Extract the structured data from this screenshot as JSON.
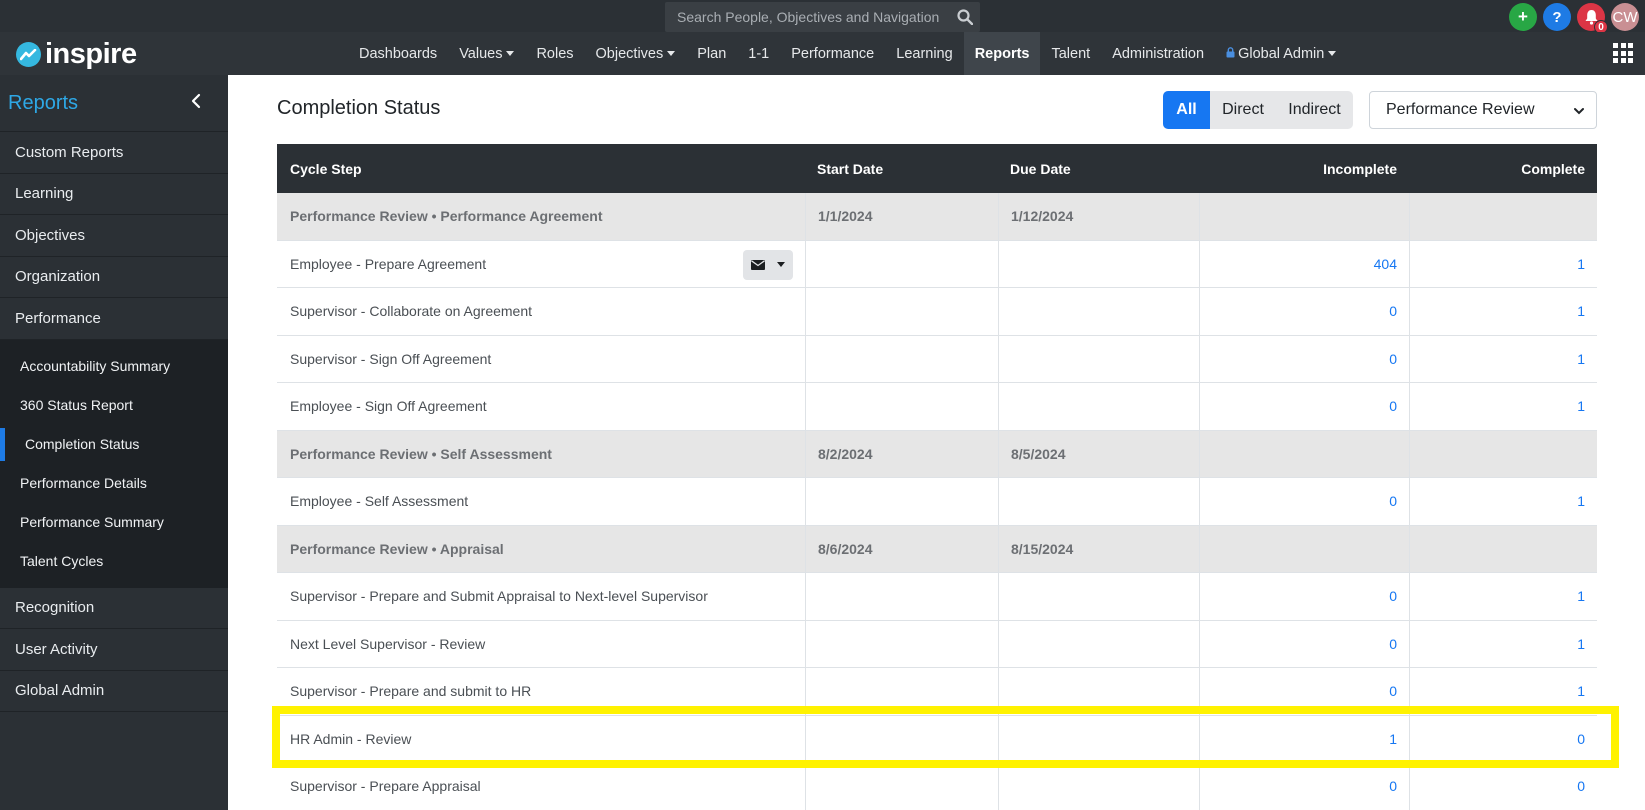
{
  "search": {
    "placeholder": "Search People, Objectives and Navigation"
  },
  "top_icons": {
    "add": "+",
    "help": "?",
    "notification_count": "0",
    "avatar_initials": "CW"
  },
  "logo": {
    "text": "inspire"
  },
  "nav": {
    "items": [
      {
        "label": "Dashboards",
        "caret": false
      },
      {
        "label": "Values",
        "caret": true
      },
      {
        "label": "Roles",
        "caret": false
      },
      {
        "label": "Objectives",
        "caret": true
      },
      {
        "label": "Plan",
        "caret": false
      },
      {
        "label": "1-1",
        "caret": false
      },
      {
        "label": "Performance",
        "caret": false
      },
      {
        "label": "Learning",
        "caret": false
      },
      {
        "label": "Reports",
        "caret": false,
        "active": true
      },
      {
        "label": "Talent",
        "caret": false
      },
      {
        "label": "Administration",
        "caret": false
      },
      {
        "label": "Global Admin",
        "caret": true,
        "lock": true
      }
    ]
  },
  "sidebar": {
    "title": "Reports",
    "items_top": [
      "Custom Reports",
      "Learning",
      "Objectives",
      "Organization",
      "Performance"
    ],
    "sub_items": [
      "Accountability Summary",
      "360 Status Report",
      "Completion Status",
      "Performance Details",
      "Performance Summary",
      "Talent Cycles"
    ],
    "active_sub": "Completion Status",
    "items_bottom": [
      "Recognition",
      "User Activity",
      "Global Admin"
    ]
  },
  "main": {
    "title": "Completion Status",
    "filters": {
      "all": "All",
      "direct": "Direct",
      "indirect": "Indirect"
    },
    "select_value": "Performance Review"
  },
  "table": {
    "headers": {
      "cycle_step": "Cycle Step",
      "start_date": "Start Date",
      "due_date": "Due Date",
      "incomplete": "Incomplete",
      "complete": "Complete"
    },
    "rows": [
      {
        "type": "group",
        "step": "Performance Review • Performance Agreement",
        "start": "1/1/2024",
        "due": "1/12/2024",
        "incomplete": "",
        "complete": ""
      },
      {
        "type": "item",
        "step": "Employee - Prepare Agreement",
        "start": "",
        "due": "",
        "incomplete": "404",
        "complete": "1",
        "mail": true
      },
      {
        "type": "item",
        "step": "Supervisor - Collaborate on Agreement",
        "start": "",
        "due": "",
        "incomplete": "0",
        "complete": "1"
      },
      {
        "type": "item",
        "step": "Supervisor - Sign Off Agreement",
        "start": "",
        "due": "",
        "incomplete": "0",
        "complete": "1"
      },
      {
        "type": "item",
        "step": "Employee - Sign Off Agreement",
        "start": "",
        "due": "",
        "incomplete": "0",
        "complete": "1"
      },
      {
        "type": "group",
        "step": "Performance Review • Self Assessment",
        "start": "8/2/2024",
        "due": "8/5/2024",
        "incomplete": "",
        "complete": ""
      },
      {
        "type": "item",
        "step": "Employee - Self Assessment",
        "start": "",
        "due": "",
        "incomplete": "0",
        "complete": "1"
      },
      {
        "type": "group",
        "step": "Performance Review • Appraisal",
        "start": "8/6/2024",
        "due": "8/15/2024",
        "incomplete": "",
        "complete": ""
      },
      {
        "type": "item",
        "step": "Supervisor - Prepare and Submit Appraisal to Next-level Supervisor",
        "start": "",
        "due": "",
        "incomplete": "0",
        "complete": "1"
      },
      {
        "type": "item",
        "step": "Next Level Supervisor - Review",
        "start": "",
        "due": "",
        "incomplete": "0",
        "complete": "1"
      },
      {
        "type": "item",
        "step": "Supervisor - Prepare and submit to HR",
        "start": "",
        "due": "",
        "incomplete": "0",
        "complete": "1"
      },
      {
        "type": "item",
        "step": "HR Admin - Review",
        "start": "",
        "due": "",
        "incomplete": "1",
        "complete": "0"
      },
      {
        "type": "item",
        "step": "Supervisor - Prepare Appraisal",
        "start": "",
        "due": "",
        "incomplete": "0",
        "complete": "0"
      }
    ]
  },
  "colors": {
    "accent": "#1677f2",
    "sidebar_title": "#2ea8e6",
    "highlight": "#fff200",
    "dark_bg": "#2b3035"
  }
}
